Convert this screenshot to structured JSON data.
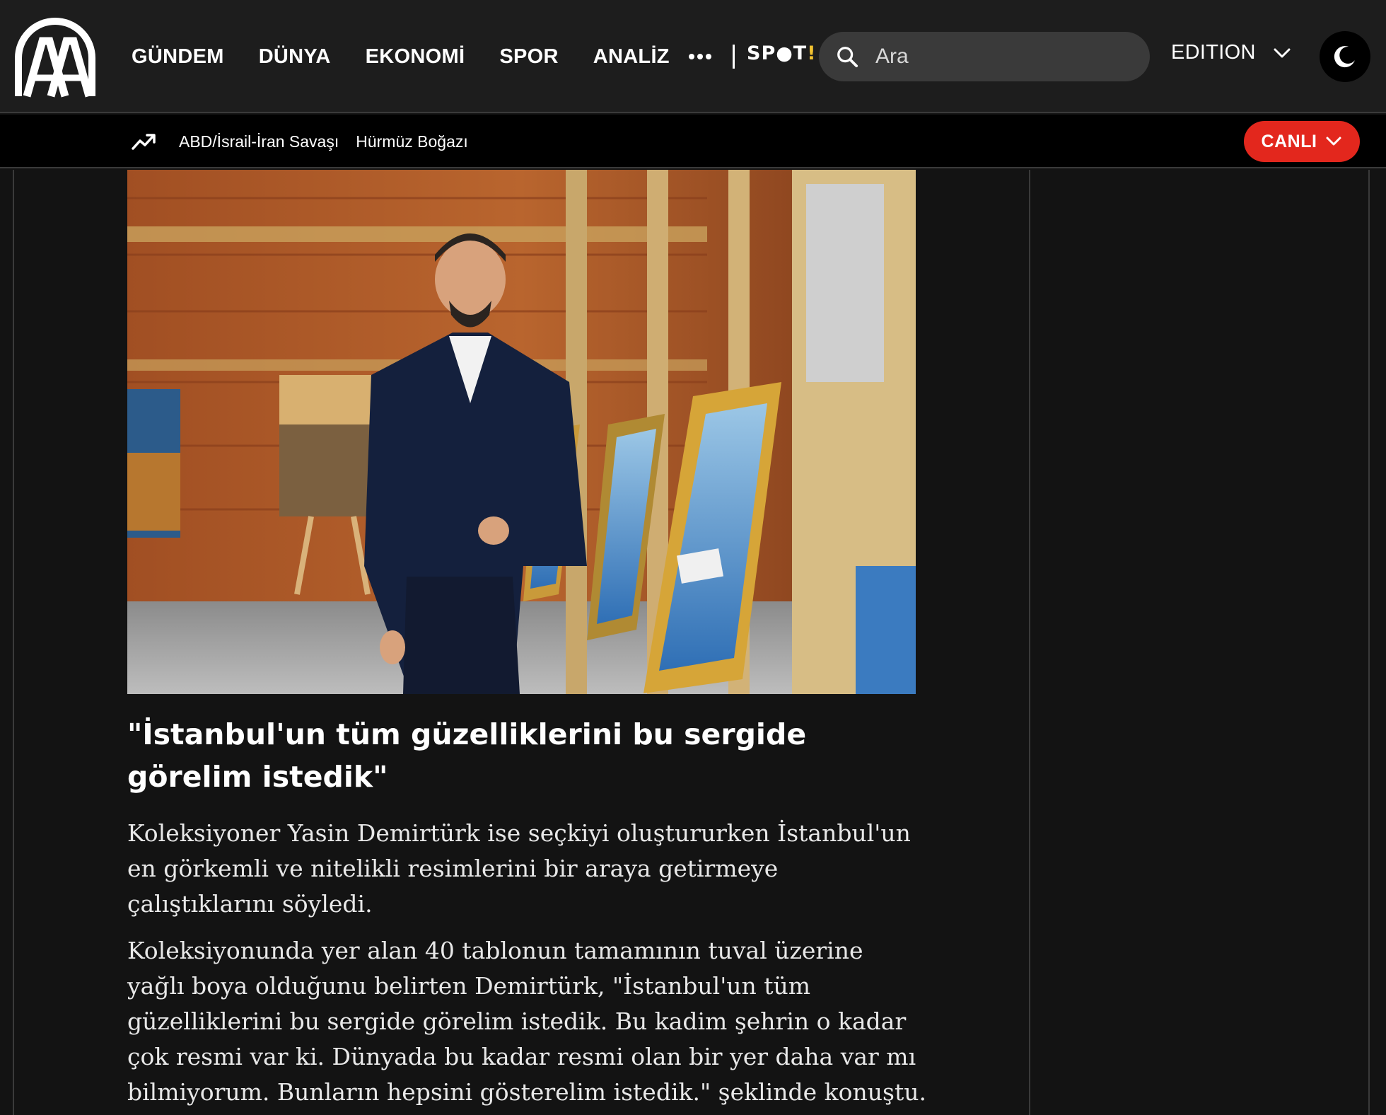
{
  "header": {
    "logo_text": "AA",
    "nav": [
      "GÜNDEM",
      "DÜNYA",
      "EKONOMİ",
      "SPOR",
      "ANALİZ"
    ],
    "more_icon": "ellipsis-icon",
    "spot_label": "SP●T",
    "spot_bang": "!",
    "search": {
      "placeholder": "Ara",
      "value": ""
    },
    "edition_label": "EDITION",
    "theme_icon": "moon-icon"
  },
  "trending": {
    "icon": "trending-up-icon",
    "links": [
      "ABD/İsrail-İran Savaşı",
      "Hürmüz Boğazı"
    ],
    "live_label": "CANLI"
  },
  "article": {
    "image_alt": "Koleksiyoner Yasin Demirtürk sergide tabloların önünde",
    "subheading": "\"İstanbul'un tüm güzelliklerini bu sergide görelim istedik\"",
    "paragraphs": [
      "Koleksiyoner Yasin Demirtürk ise seçkiyi oluştururken İstanbul'un en görkemli ve nitelikli resimlerini bir araya getirmeye çalıştıklarını söyledi.",
      "Koleksiyonunda yer alan 40 tablonun tamamının tuval üzerine yağlı boya olduğunu belirten Demirtürk, \"İstanbul'un tüm güzelliklerini bu sergide görelim istedik. Bu kadim şehrin o kadar çok resmi var ki. Dünyada bu kadar resmi olan bir yer daha var mı bilmiyorum. Bunların hepsini gösterelim istedik.\" şeklinde konuştu."
    ]
  },
  "colors": {
    "background": "#131313",
    "header_bg": "#1d1d1d",
    "search_bg": "#3a3a3a",
    "live_red": "#e3271d",
    "spot_accent": "#f2c230"
  }
}
